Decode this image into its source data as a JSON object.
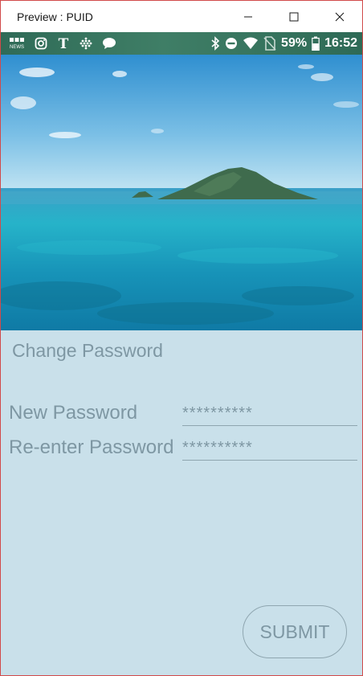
{
  "window": {
    "title": "Preview : PUID",
    "controls": [
      "minimize-icon",
      "maximize-icon",
      "close-icon"
    ]
  },
  "statusbar": {
    "left_icons": [
      "bbc-news-icon",
      "instagram-icon",
      "nytimes-icon",
      "dots-grid-icon",
      "chat-bubble-icon"
    ],
    "bbc_line1": "BBC",
    "bbc_line2": "NEWS",
    "right_icons": [
      "bluetooth-icon",
      "do-not-disturb-icon",
      "wifi-icon",
      "no-sim-icon",
      "battery-icon"
    ],
    "battery": "59%",
    "time": "16:52"
  },
  "hero": {
    "image": "island-ocean-photo"
  },
  "form": {
    "title": "Change Password",
    "new_password_label": "New Password",
    "new_password_value": "**********",
    "reenter_password_label": "Re-enter Password",
    "reenter_password_value": "**********",
    "submit_label": "SUBMIT"
  },
  "colors": {
    "background": "#c9e0ea",
    "text": "#7e97a3",
    "statusbar": "#3a765f",
    "window_border": "#d24a4a"
  }
}
